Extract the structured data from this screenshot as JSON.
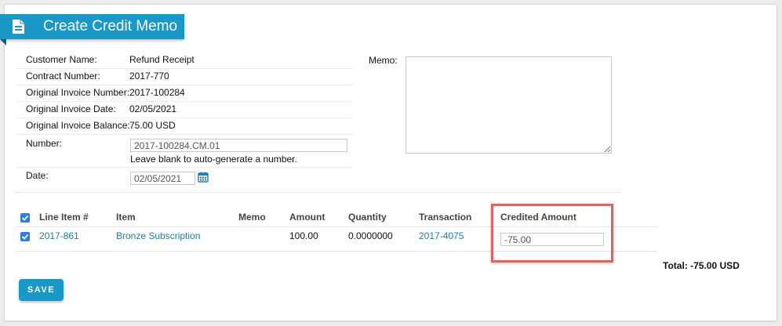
{
  "title": "Create Credit Memo",
  "info": {
    "customer_name_label": "Customer Name:",
    "customer_name": "Refund Receipt",
    "contract_number_label": "Contract Number:",
    "contract_number": "2017-770",
    "orig_invoice_number_label": "Original Invoice Number:",
    "orig_invoice_number": "2017-100284",
    "orig_invoice_date_label": "Original Invoice Date:",
    "orig_invoice_date": "02/05/2021",
    "orig_invoice_balance_label": "Original Invoice Balance:",
    "orig_invoice_balance": "75.00 USD",
    "number_label": "Number:",
    "number_value": "2017-100284.CM.01",
    "number_hint": "Leave blank to auto-generate a number.",
    "date_label": "Date:",
    "date_value": "02/05/2021"
  },
  "memo": {
    "label": "Memo:",
    "value": ""
  },
  "table": {
    "headers": {
      "line_item": "Line Item #",
      "item": "Item",
      "memo": "Memo",
      "amount": "Amount",
      "quantity": "Quantity",
      "transaction": "Transaction",
      "credited_amount": "Credited Amount"
    },
    "header_checked": true,
    "rows": [
      {
        "checked": true,
        "line_item": "2017-861",
        "item": "Bronze Subscription",
        "memo": "",
        "amount": "100.00",
        "quantity": "0.0000000",
        "transaction": "2017-4075",
        "credited_amount": "-75.00"
      }
    ]
  },
  "total": "Total: -75.00 USD",
  "save_label": "SAVE",
  "colors": {
    "accent": "#1a98c7",
    "link": "#1a7fad",
    "highlight": "#e4615c",
    "checkbox": "#2f7de1"
  },
  "icons": {
    "title": "document-icon",
    "date": "calendar-icon"
  }
}
